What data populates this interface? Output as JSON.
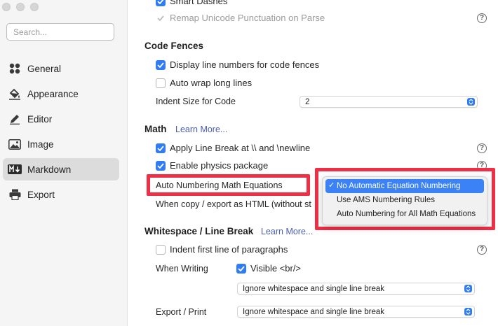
{
  "sidebar": {
    "search_placeholder": "Search...",
    "items": [
      {
        "label": "General",
        "icon": "grid-icon"
      },
      {
        "label": "Appearance",
        "icon": "paint-bucket-icon"
      },
      {
        "label": "Editor",
        "icon": "pencil-icon"
      },
      {
        "label": "Image",
        "icon": "image-icon"
      },
      {
        "label": "Markdown",
        "icon": "markdown-icon",
        "active": true
      },
      {
        "label": "Export",
        "icon": "printer-icon"
      }
    ]
  },
  "top": {
    "smart_dashes": "Smart Dashes",
    "remap_unicode": "Remap Unicode Punctuation on Parse"
  },
  "code_fences": {
    "title": "Code Fences",
    "display_line_numbers": "Display line numbers for code fences",
    "auto_wrap": "Auto wrap long lines",
    "indent_label": "Indent Size for Code",
    "indent_value": "2"
  },
  "math": {
    "title": "Math",
    "learn_more": "Learn More...",
    "line_break": "Apply Line Break at \\\\ and \\newline",
    "physics": "Enable physics package",
    "auto_numbering_label": "Auto Numbering Math Equations",
    "copy_export_label": "When copy / export as HTML (without st",
    "numbering_options": [
      "No Automatic Equation Numbering",
      "Use AMS Numbering Rules",
      "Auto Numbering for All Math Equations"
    ],
    "check_mark": "✓"
  },
  "whitespace": {
    "title": "Whitespace / Line Break",
    "learn_more": "Learn More...",
    "indent_first_line": "Indent first line of paragraphs",
    "when_writing_label": "When Writing",
    "visible_br": "Visible <br/>",
    "when_writing_select": "Ignore whitespace and single line break",
    "export_print_label": "Export / Print",
    "export_print_select": "Ignore whitespace and single line break"
  },
  "help_glyph": "?",
  "colors": {
    "accent": "#2f7cf6",
    "highlight_border": "#ee2f46",
    "selected_option": "#3b82f6"
  }
}
